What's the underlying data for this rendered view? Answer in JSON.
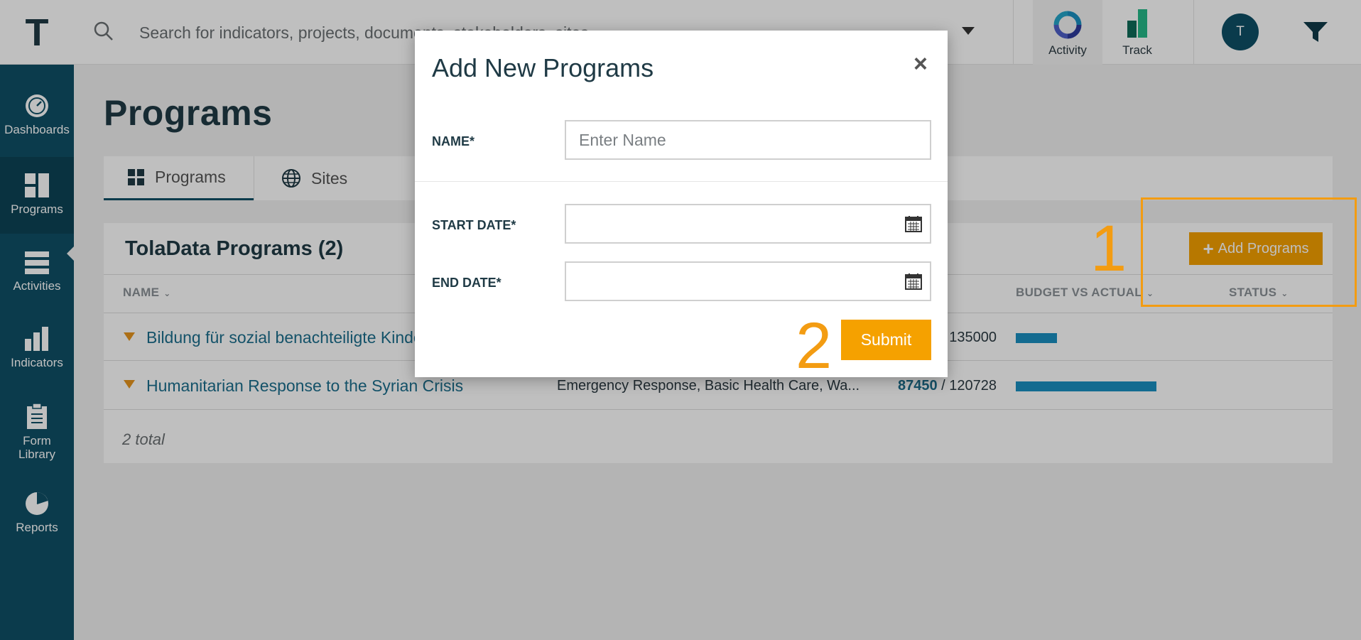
{
  "app": {
    "logo_letter": "T"
  },
  "search": {
    "placeholder": "Search for indicators, projects, documents, stakeholders, sites..."
  },
  "top_apps": [
    {
      "label": "Activity",
      "icon": "activity-ring-icon"
    },
    {
      "label": "Track",
      "icon": "track-bars-icon"
    }
  ],
  "user": {
    "avatar_initial": "T"
  },
  "sidebar": {
    "items": [
      {
        "label": "Dashboards",
        "icon": "gauge-icon"
      },
      {
        "label": "Programs",
        "icon": "layout-grid-icon",
        "active": true
      },
      {
        "label": "Activities",
        "icon": "stack-icon"
      },
      {
        "label": "Indicators",
        "icon": "bar-chart-icon"
      },
      {
        "label": "Form Library",
        "icon": "clipboard-icon"
      },
      {
        "label": "Reports",
        "icon": "pie-chart-icon"
      }
    ]
  },
  "page": {
    "title": "Programs"
  },
  "tabs": [
    {
      "label": "Programs",
      "icon": "grid-icon",
      "active": true
    },
    {
      "label": "Sites",
      "icon": "globe-icon"
    }
  ],
  "panel": {
    "title": "TolaData Programs (2)",
    "columns": {
      "name": "NAME",
      "budget": "BUDGET VS ACTUAL",
      "status": "STATUS"
    },
    "rows": [
      {
        "name": "Bildung für sozial benachteiligte Kinder",
        "sector": "",
        "actual": "",
        "budget_text": "135000",
        "ratio": 0.21
      },
      {
        "name": "Humanitarian Response to the Syrian Crisis",
        "sector": "Emergency Response, Basic Health Care, Wa...",
        "actual": "87450",
        "budget_text": " / 120728",
        "ratio": 0.72
      }
    ],
    "total": "2 total",
    "add_button": "Add Programs"
  },
  "modal": {
    "title": "Add New Programs",
    "close": "×",
    "name_label": "NAME*",
    "name_placeholder": "Enter Name",
    "start_label": "START DATE*",
    "end_label": "END DATE*",
    "submit": "Submit"
  },
  "annotations": {
    "step1": "1",
    "step2": "2"
  },
  "colors": {
    "sidebar": "#0f4f66",
    "accent": "#f5a100",
    "annotation": "#f39c12",
    "bar": "#1a8fc0"
  }
}
